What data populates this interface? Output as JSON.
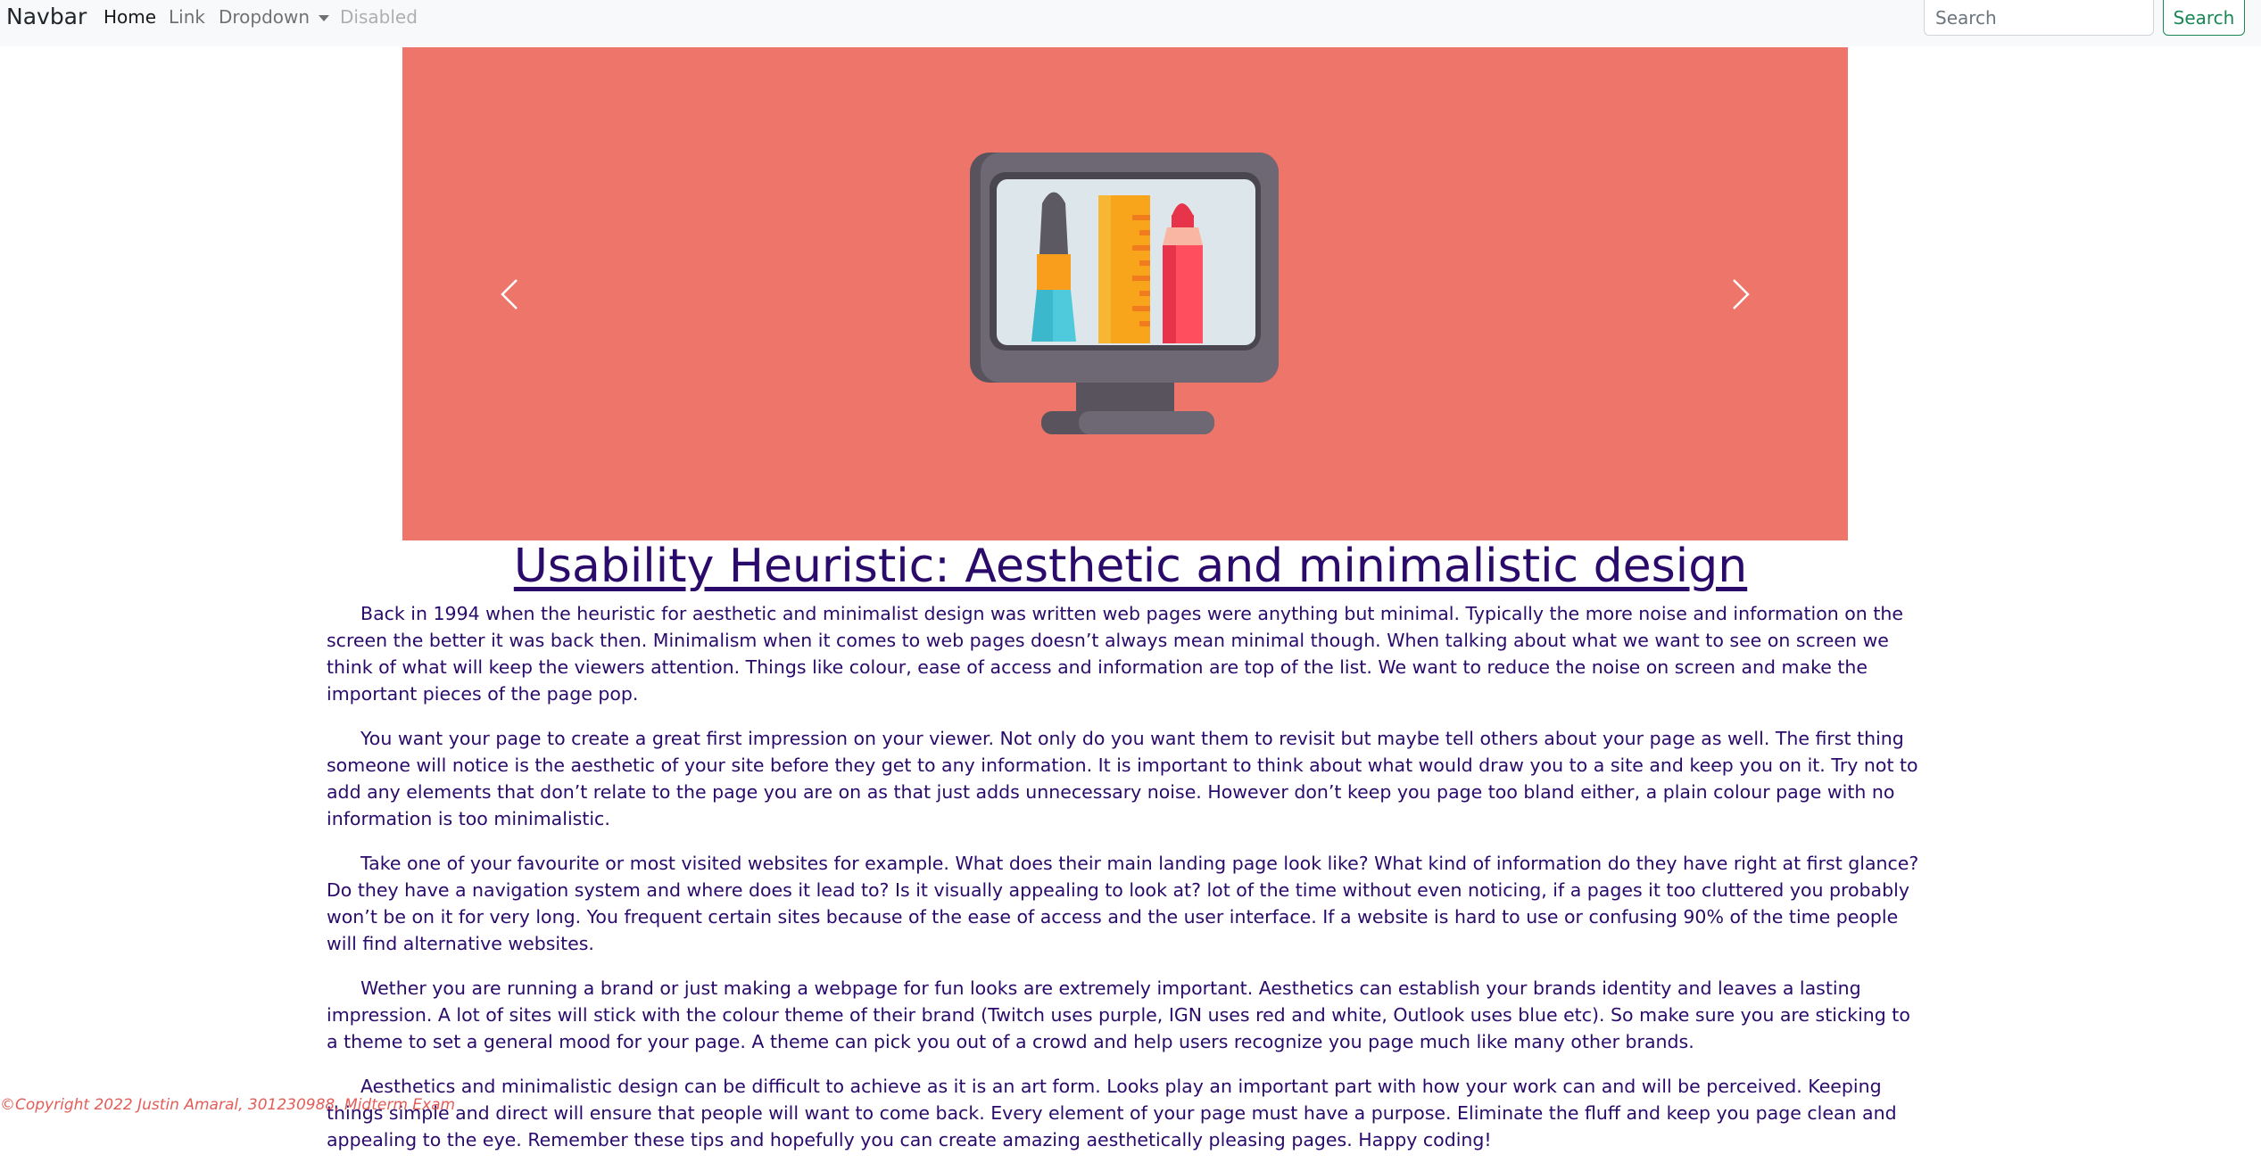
{
  "navbar": {
    "brand": "Navbar",
    "links": {
      "home": "Home",
      "link": "Link",
      "dropdown": "Dropdown",
      "disabled": "Disabled"
    },
    "search": {
      "placeholder": "Search",
      "button": "Search"
    }
  },
  "carousel": {
    "background": "#ee756a",
    "image_icon": "monitor-with-art-tools-icon",
    "prev_icon": "chevron-left-icon",
    "next_icon": "chevron-right-icon"
  },
  "article": {
    "title": "Usability Heuristic: Aesthetic and minimalistic design",
    "paragraphs": [
      "Back in 1994 when the heuristic for aesthetic and minimalist design was written web pages were anything but minimal. Typically the more noise and information on the screen the better it was back then. Minimalism when it comes to web pages doesn’t always mean minimal though. When talking about what we want to see on screen we think of what will keep the viewers attention. Things like colour, ease of access and information are top of the list. We want to reduce the noise on screen and make the important pieces of the page pop.",
      "You want your page to create a great first impression on your viewer. Not only do you want them to revisit but maybe tell others about your page as well. The first thing someone will notice is the aesthetic of your site before they get to any information. It is important to think about what would draw you to a site and keep you on it. Try not to add any elements that don’t relate to the page you are on as that just adds unnecessary noise. However don’t keep you page too bland either, a plain colour page with no information is too minimalistic.",
      "Take one of your favourite or most visited websites for example. What does their main landing page look like? What kind of information do they have right at first glance? Do they have a navigation system and where does it lead to? Is it visually appealing to look at? lot of the time without even noticing, if a pages it too cluttered you probably won’t be on it for very long. You frequent certain sites because of the ease of access and the user interface. If a website is hard to use or confusing 90% of the time people will find alternative websites.",
      "Wether you are running a brand or just making a webpage for fun looks are extremely important. Aesthetics can establish your brands identity and leaves a lasting impression. A lot of sites will stick with the colour theme of their brand (Twitch uses purple, IGN uses red and white, Outlook uses blue etc). So make sure you are sticking to a theme to set a general mood for your page. A theme can pick you out of a crowd and help users recognize you page much like many other brands.",
      "Aesthetics and minimalistic design can be difficult to achieve as it is an art form. Looks play an important part with how your work can and will be perceived. Keeping things simple and direct will ensure that people will want to come back. Every element of your page must have a purpose. Eliminate the fluff and keep you page clean and appealing to the eye. Remember these tips and hopefully you can create amazing aesthetically pleasing pages. Happy coding!"
    ]
  },
  "footer": {
    "text": "©Copyright 2022 Justin Amaral, 301230988, Midterm Exam"
  }
}
